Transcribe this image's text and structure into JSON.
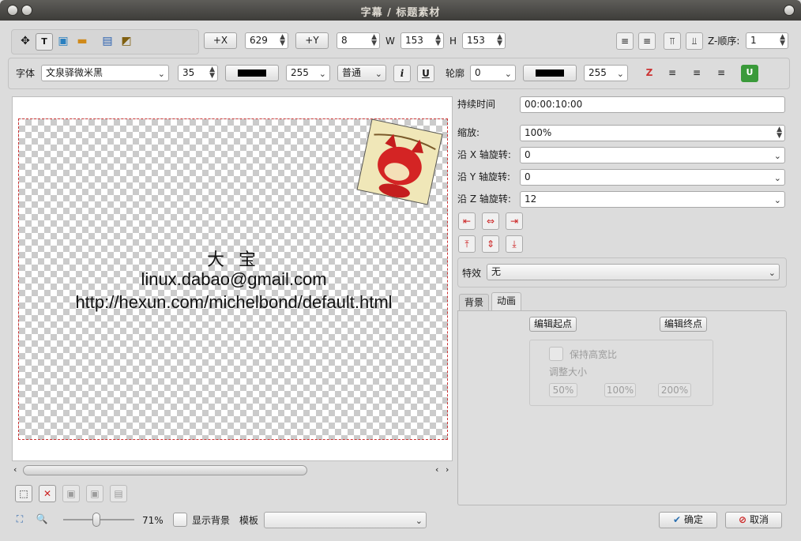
{
  "window": {
    "title": "字幕 / 标题素材"
  },
  "toolbar1": {
    "x_label": "+X",
    "x_value": "629",
    "y_label": "+Y",
    "y_value": "8",
    "w_label": "W",
    "w_value": "153",
    "h_label": "H",
    "h_value": "153",
    "z_label": "Z-顺序:",
    "z_value": "1"
  },
  "toolbar2": {
    "font_label": "字体",
    "font_value": "文泉驿微米黑",
    "size_value": "35",
    "alpha_value": "255",
    "weight_value": "普通",
    "outline_label": "轮廓",
    "outline_value": "0",
    "outline_alpha": "255",
    "text_color": "#000000",
    "outline_color": "#000000"
  },
  "canvas": {
    "line1": "大 宝",
    "line2": "linux.dabao@gmail.com",
    "line3": "http://hexun.com/michelbond/default.html"
  },
  "props": {
    "duration_label": "持续时间",
    "duration_value": "00:00:10:00",
    "zoom_label": "缩放:",
    "zoom_value": "100%",
    "rotx_label": "沿 X 轴旋转:",
    "rotx_value": "0",
    "roty_label": "沿 Y 轴旋转:",
    "roty_value": "0",
    "rotz_label": "沿 Z 轴旋转:",
    "rotz_value": "12",
    "effect_label": "特效",
    "effect_value": "无"
  },
  "tabs": {
    "background": "背景",
    "animation": "动画"
  },
  "animation": {
    "edit_start": "编辑起点",
    "edit_end": "编辑终点",
    "keep_ratio": "保持高宽比",
    "resize_label": "调整大小",
    "p50": "50%",
    "p100": "100%",
    "p200": "200%"
  },
  "bottom": {
    "zoom_percent": "71%",
    "show_bg": "显示背景",
    "template_label": "模板",
    "template_value": "",
    "ok": "确定",
    "cancel": "取消"
  },
  "colors": {
    "accent": "#cc3333",
    "titlebar": "#3d3c39",
    "ok_icon": "#2a6fb0",
    "cancel_icon": "#cc2222"
  }
}
